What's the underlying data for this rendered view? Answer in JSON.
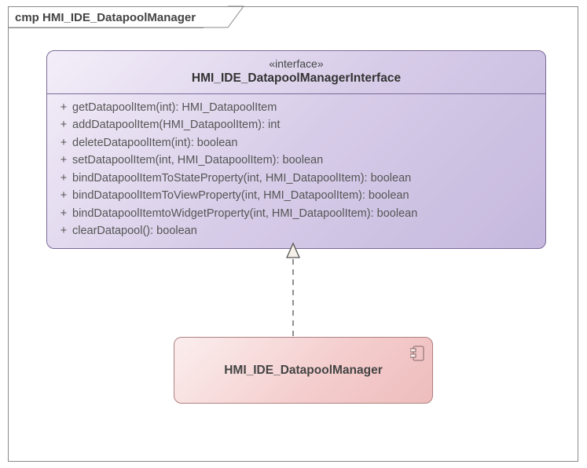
{
  "frame": {
    "label": "cmp HMI_IDE_DatapoolManager"
  },
  "interface": {
    "stereotype": "«interface»",
    "name": "HMI_IDE_DatapoolManagerInterface",
    "operations": [
      {
        "visibility": "+",
        "signature": "getDatapoolItem(int): HMI_DatapoolItem"
      },
      {
        "visibility": "+",
        "signature": "addDatapoolItem(HMI_DatapoolItem): int"
      },
      {
        "visibility": "+",
        "signature": "deleteDatapoolItem(int): boolean"
      },
      {
        "visibility": "+",
        "signature": "setDatapoolItem(int, HMI_DatapoolItem): boolean"
      },
      {
        "visibility": "+",
        "signature": "bindDatapoolItemToStateProperty(int, HMI_DatapoolItem): boolean"
      },
      {
        "visibility": "+",
        "signature": "bindDatapoolItemToViewProperty(int, HMI_DatapoolItem): boolean"
      },
      {
        "visibility": "+",
        "signature": "bindDatapoolItemtoWidgetProperty(int, HMI_DatapoolItem): boolean"
      },
      {
        "visibility": "+",
        "signature": "clearDatapool(): boolean"
      }
    ]
  },
  "component": {
    "name": "HMI_IDE_DatapoolManager"
  },
  "connector": {
    "type": "realization",
    "from": "HMI_IDE_DatapoolManager",
    "to": "HMI_IDE_DatapoolManagerInterface"
  }
}
